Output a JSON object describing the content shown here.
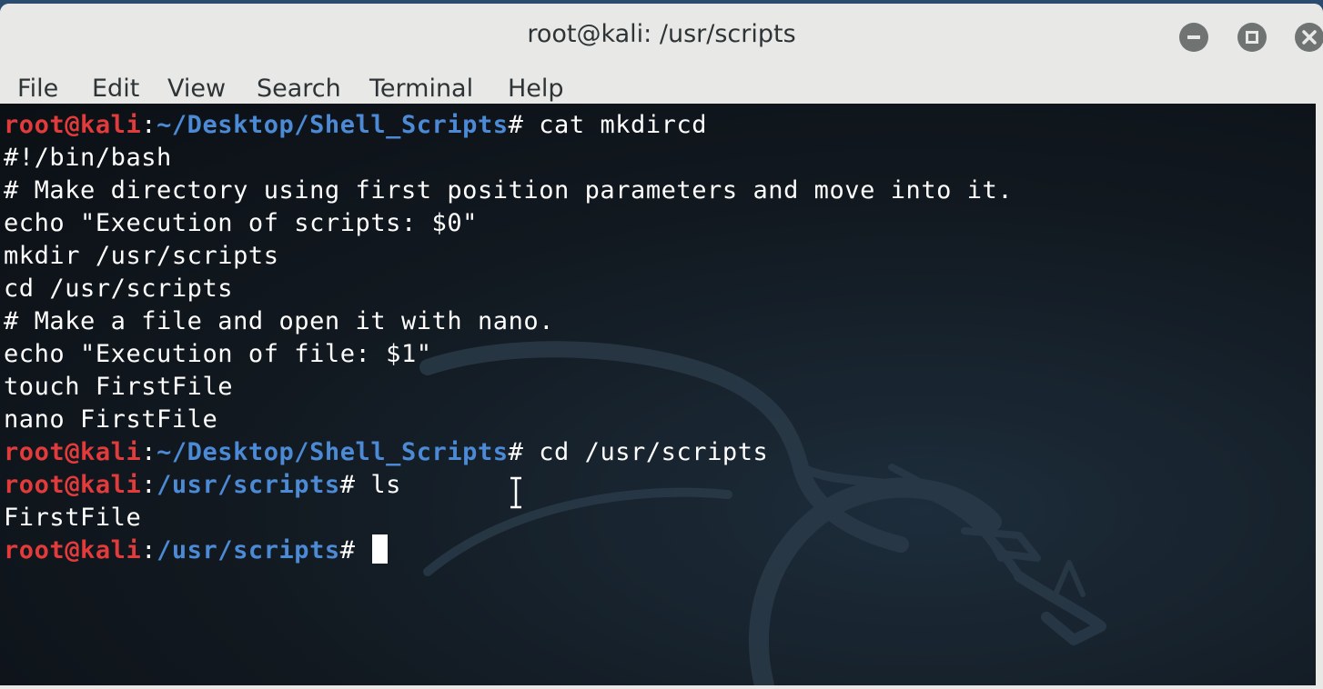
{
  "window": {
    "title": "root@kali: /usr/scripts",
    "controls": [
      "minimize-icon",
      "maximize-icon",
      "close-icon"
    ]
  },
  "menu": [
    "File",
    "Edit",
    "View",
    "Search",
    "Terminal",
    "Help"
  ],
  "terminal": {
    "lines": [
      {
        "type": "prompt",
        "user": "root@kali",
        "colon": ":",
        "path": "~/Desktop/Shell_Scripts",
        "hash": "# ",
        "cmd": "cat mkdircd"
      },
      {
        "type": "out",
        "text": "#!/bin/bash"
      },
      {
        "type": "out",
        "text": "# Make directory using first position parameters and move into it."
      },
      {
        "type": "out",
        "text": "echo \"Execution of scripts: $0\""
      },
      {
        "type": "out",
        "text": "mkdir /usr/scripts"
      },
      {
        "type": "out",
        "text": "cd /usr/scripts"
      },
      {
        "type": "out",
        "text": "# Make a file and open it with nano."
      },
      {
        "type": "out",
        "text": "echo \"Execution of file: $1\""
      },
      {
        "type": "out",
        "text": "touch FirstFile"
      },
      {
        "type": "out",
        "text": "nano FirstFile"
      },
      {
        "type": "prompt",
        "user": "root@kali",
        "colon": ":",
        "path": "~/Desktop/Shell_Scripts",
        "hash": "# ",
        "cmd": "cd /usr/scripts"
      },
      {
        "type": "prompt",
        "user": "root@kali",
        "colon": ":",
        "path": "/usr/scripts",
        "hash": "# ",
        "cmd": "ls"
      },
      {
        "type": "out",
        "text": "FirstFile"
      },
      {
        "type": "prompt",
        "user": "root@kali",
        "colon": ":",
        "path": "/usr/scripts",
        "hash": "# ",
        "cmd": "",
        "cursor": true
      }
    ]
  },
  "colors": {
    "prompt_user": "#e23b3b",
    "prompt_path": "#4c8ad6",
    "text": "#ffffff",
    "background": "#11181f",
    "chrome": "#e8e8e7"
  }
}
